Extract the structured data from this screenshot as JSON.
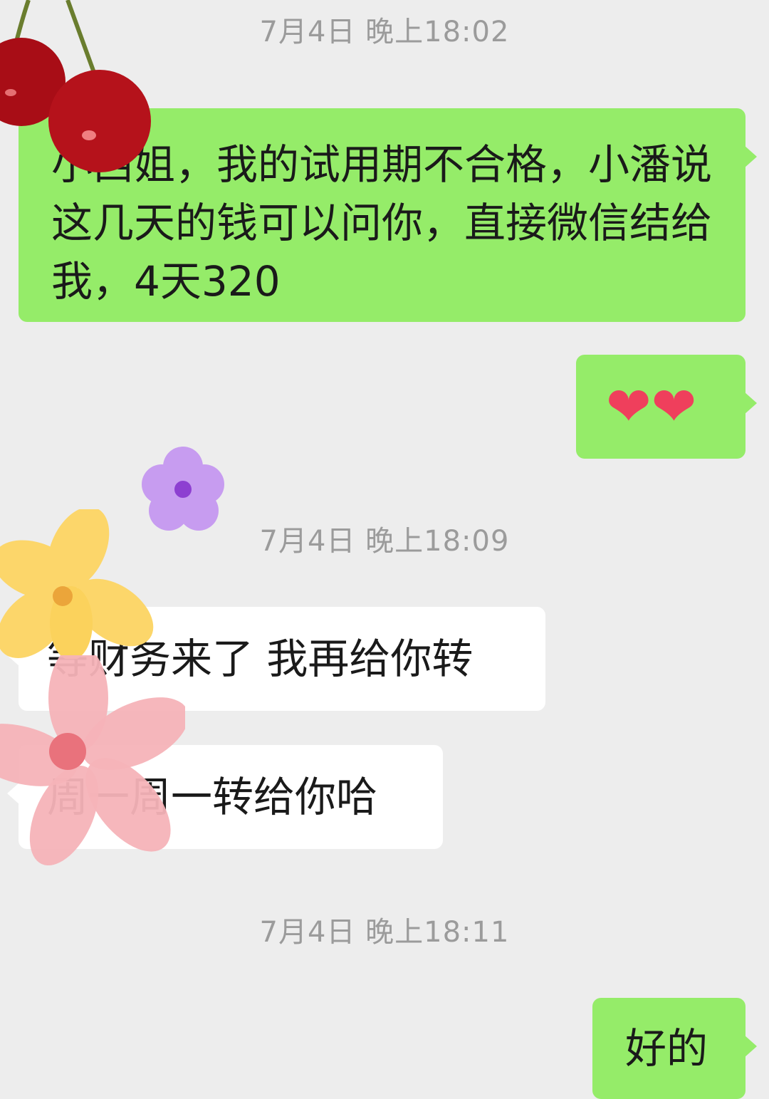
{
  "messages": [
    {
      "type": "timestamp",
      "text": "7月4日 晚上18:02"
    },
    {
      "type": "sent",
      "text": "小西姐，我的试用期不合格，小潘说这几天的钱可以问你，直接微信结给我，4天320"
    },
    {
      "type": "sent",
      "emoji": "❤❤"
    },
    {
      "type": "timestamp",
      "text": "7月4日 晚上18:09"
    },
    {
      "type": "received",
      "text": "等财务来了 我再给你转"
    },
    {
      "type": "received",
      "text": "周一周一转给你哈"
    },
    {
      "type": "timestamp",
      "text": "7月4日 晚上18:11"
    },
    {
      "type": "sent",
      "text": "好的"
    }
  ],
  "decorations": {
    "cherries": "cherry-sticker",
    "flowers": [
      "purple-flower-sticker",
      "yellow-flower-sticker",
      "pink-flower-sticker"
    ]
  },
  "colors": {
    "background": "#ededed",
    "sent_bubble": "#95ec69",
    "received_bubble": "#ffffff",
    "timestamp": "#9b9b9b"
  }
}
